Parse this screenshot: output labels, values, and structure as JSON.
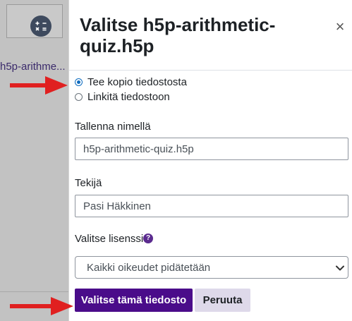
{
  "background": {
    "file_name": "h5p-arithme..."
  },
  "dialog": {
    "title": "Valitse h5p-arithmetic-quiz.h5p",
    "close_glyph": "×",
    "options": [
      {
        "label": "Tee kopio tiedostosta",
        "checked": true
      },
      {
        "label": "Linkitä tiedostoon",
        "checked": false
      }
    ],
    "save_as": {
      "label": "Tallenna nimellä",
      "value": "h5p-arithmetic-quiz.h5p"
    },
    "author": {
      "label": "Tekijä",
      "value": "Pasi Häkkinen"
    },
    "license": {
      "label": "Valitse lisenssi",
      "help_glyph": "?",
      "selected": "Kaikki oikeudet pidätetään"
    },
    "buttons": {
      "select_label": "Valitse tämä tiedosto",
      "cancel_label": "Peruuta"
    }
  },
  "colors": {
    "primary": "#4a0c8a",
    "secondary": "#ded9ea",
    "annotation": "#e02020",
    "radio_accent": "#0f6cbf"
  },
  "icons": {
    "file_tile": "arithmetic-icon",
    "arrows": "annotation-arrow-icon"
  }
}
